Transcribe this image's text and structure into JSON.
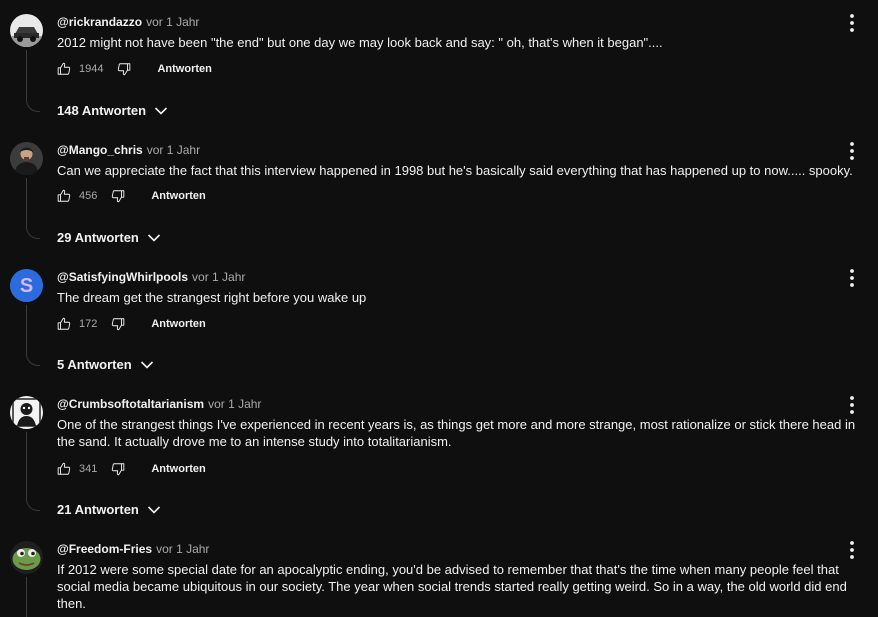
{
  "comments": [
    {
      "author": "@rickrandazzo",
      "time": "vor 1 Jahr",
      "text": "2012 might not have been \"the end\" but one day we may look back and say: \" oh, that's when it began\"....",
      "likes": "1944",
      "reply_label": "Antworten",
      "replies_label": "148 Antworten",
      "avatar_icon": "car-photo-avatar"
    },
    {
      "author": "@Mango_chris",
      "time": "vor 1 Jahr",
      "text": "Can we appreciate the fact that this interview happened in 1998 but he's basically said everything that has happened up to now..... spooky.",
      "likes": "456",
      "reply_label": "Antworten",
      "replies_label": "29 Antworten",
      "avatar_icon": "person-photo-avatar"
    },
    {
      "author": "@SatisfyingWhirlpools",
      "time": "vor 1 Jahr",
      "text": "The dream get the strangest right before you wake up",
      "likes": "172",
      "reply_label": "Antworten",
      "replies_label": "5 Antworten",
      "avatar_icon": "letter-s-avatar",
      "avatar_letter": "S"
    },
    {
      "author": "@Crumbsoftotaltarianism",
      "time": "vor 1 Jahr",
      "text": "One of the strangest things I've experienced in recent years is, as things get more and more strange, most rationalize or stick there head in the sand.  It actually drove me to an intense study into totalitarianism.",
      "likes": "341",
      "reply_label": "Antworten",
      "replies_label": "21 Antworten",
      "avatar_icon": "portrait-sketch-avatar"
    },
    {
      "author": "@Freedom-Fries",
      "time": "vor 1 Jahr",
      "text": "If 2012 were some special date for an apocalyptic ending, you'd be advised to remember that that's the time when many people feel that social media became ubiquitous in our society. The year when social trends started really getting weird. So in a way, the old world did end then.",
      "avatar_icon": "frog-avatar"
    }
  ],
  "colors": {
    "background": "#0f0f0f",
    "text_primary": "#f1f1f1",
    "text_secondary": "#aaaaaa",
    "avatar_s_bg": "#2b6bdc",
    "avatar_s_letter": "#d7b8f5"
  },
  "icons": {
    "like": "thumb-up-icon",
    "dislike": "thumb-down-icon",
    "expand": "chevron-down-icon",
    "menu": "more-vert-icon"
  }
}
